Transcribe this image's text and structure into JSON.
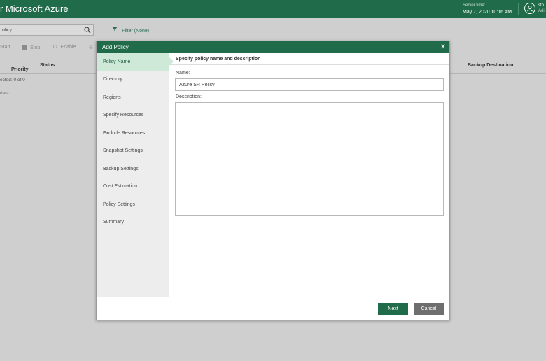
{
  "header": {
    "app_title": "r Microsoft Azure",
    "server_time_label": "Server time:",
    "server_time": "May 7, 2020 10:16 AM",
    "user_name": "sto",
    "user_role": "Adi"
  },
  "toolbar": {
    "search_value": "olicy",
    "filter_label": "Filter (None)",
    "actions": [
      "Start",
      "Stop",
      "Enable"
    ]
  },
  "grid": {
    "columns": [
      "Priority",
      "Status",
      "Backup Destination"
    ],
    "sort_arrow": "↑",
    "selected_text": "ected:  0 of 0",
    "no_data": "data"
  },
  "modal": {
    "title": "Add Policy",
    "steps": [
      "Policy Name",
      "Directory",
      "Regions",
      "Specify Resources",
      "Exclude Resources",
      "Snapshot Settings",
      "Backup Settings",
      "Cost Estimation",
      "Policy Settings",
      "Summary"
    ],
    "active_step": 0,
    "content_title": "Specify policy name and description",
    "name_label": "Name:",
    "name_value": "Azure SR Policy",
    "description_label": "Description:",
    "description_value": "",
    "next_label": "Next",
    "cancel_label": "Cancel"
  },
  "colors": {
    "brand_green": "#1f6b4a",
    "active_step_bg": "#cfe9d9",
    "cancel_gray": "#6e6e6e"
  }
}
